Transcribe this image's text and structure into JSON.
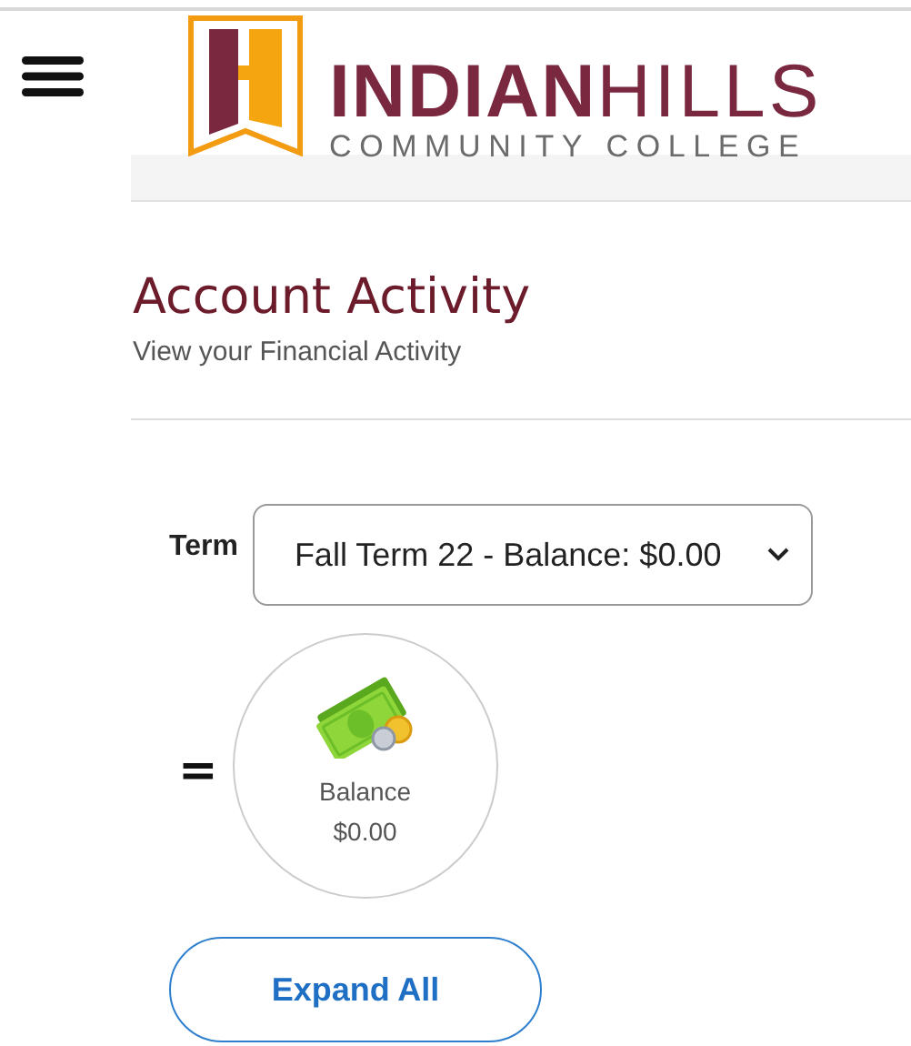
{
  "header": {
    "logo": {
      "bold": "INDIAN",
      "light": "HILLS",
      "subtitle": "COMMUNITY COLLEGE"
    }
  },
  "page": {
    "title": "Account Activity",
    "subtitle": "View your Financial Activity"
  },
  "term": {
    "label": "Term",
    "value": "Fall Term 22 - Balance: $0.00"
  },
  "summary": {
    "operator": "=",
    "label": "Balance",
    "amount": "$0.00"
  },
  "buttons": [
    "Expand All"
  ]
}
